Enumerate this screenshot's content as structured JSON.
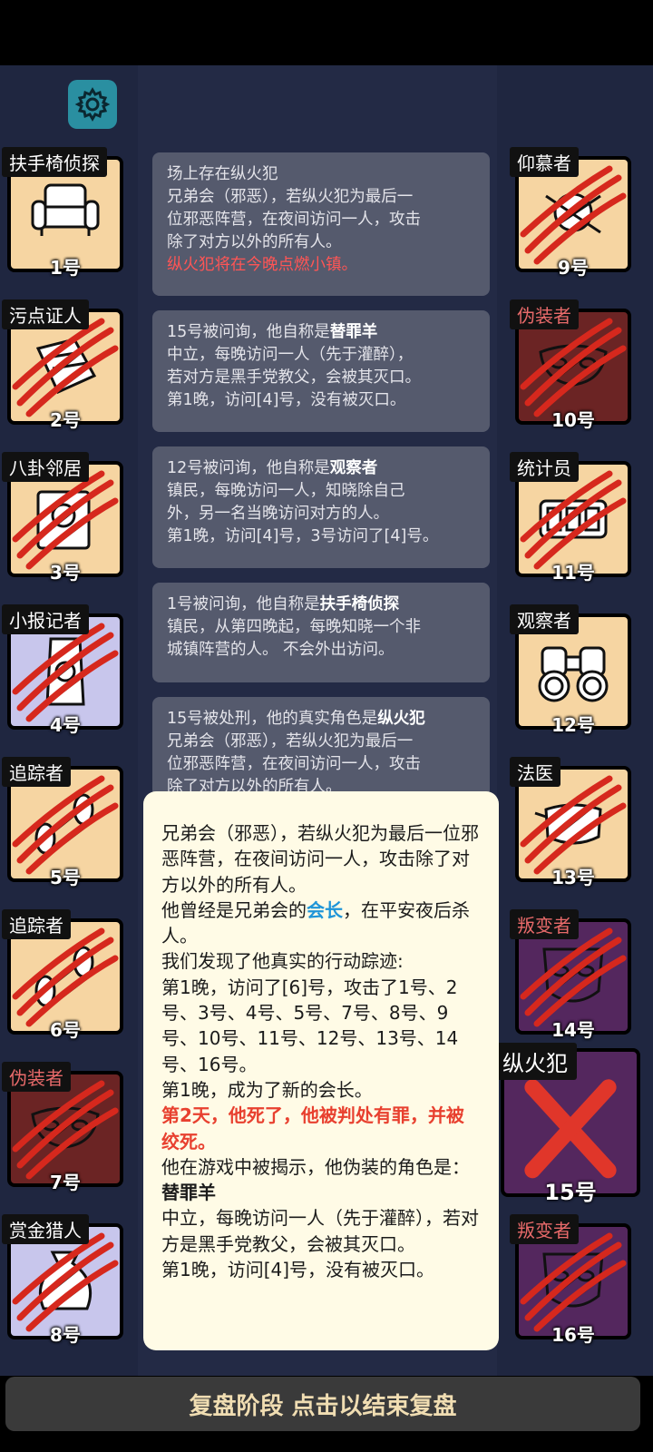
{
  "players_left": [
    {
      "role": "扶手椅侦探",
      "number": "1号",
      "bg": "peach",
      "icon": "armchair-icon",
      "slashed": false,
      "tag_color": "#ffffff"
    },
    {
      "role": "污点证人",
      "number": "2号",
      "bg": "peach",
      "icon": "paper-icon",
      "slashed": true,
      "tag_color": "#ffffff"
    },
    {
      "role": "八卦邻居",
      "number": "3号",
      "bg": "peach",
      "icon": "gossip-icon",
      "slashed": true,
      "tag_color": "#ffffff"
    },
    {
      "role": "小报记者",
      "number": "4号",
      "bg": "lav",
      "icon": "reporter-icon",
      "slashed": true,
      "tag_color": "#ffffff"
    },
    {
      "role": "追踪者",
      "number": "5号",
      "bg": "peach",
      "icon": "footprint-icon",
      "slashed": true,
      "tag_color": "#ffffff"
    },
    {
      "role": "追踪者",
      "number": "6号",
      "bg": "peach",
      "icon": "footprint-icon",
      "slashed": true,
      "tag_color": "#ffffff"
    },
    {
      "role": "伪装者",
      "number": "7号",
      "bg": "maroon",
      "icon": "mask-icon",
      "slashed": true,
      "tag_color": "#e86a6a"
    },
    {
      "role": "赏金猎人",
      "number": "8号",
      "bg": "lav",
      "icon": "money-bag-icon",
      "slashed": true,
      "tag_color": "#ffffff"
    }
  ],
  "players_right": [
    {
      "role": "仰慕者",
      "number": "9号",
      "bg": "peach",
      "icon": "admirer-icon",
      "slashed": true,
      "tag_color": "#ffffff"
    },
    {
      "role": "伪装者",
      "number": "10号",
      "bg": "maroon",
      "icon": "mask-icon",
      "slashed": true,
      "tag_color": "#e86a6a"
    },
    {
      "role": "统计员",
      "number": "11号",
      "bg": "peach",
      "icon": "counter-icon",
      "slashed": true,
      "tag_color": "#ffffff"
    },
    {
      "role": "观察者",
      "number": "12号",
      "bg": "peach",
      "icon": "binoculars-icon",
      "slashed": false,
      "tag_color": "#ffffff"
    },
    {
      "role": "法医",
      "number": "13号",
      "bg": "peach",
      "icon": "face-mask-icon",
      "slashed": true,
      "tag_color": "#ffffff"
    },
    {
      "role": "叛变者",
      "number": "14号",
      "bg": "purple",
      "icon": "traitor-mask-icon",
      "slashed": true,
      "tag_color": "#e86a6a"
    },
    {
      "role": "纵火犯",
      "number": "15号",
      "bg": "purple",
      "icon": "cross-icon",
      "slashed": false,
      "tag_color": "#ffffff"
    },
    {
      "role": "叛变者",
      "number": "16号",
      "bg": "purple",
      "icon": "traitor-mask-icon",
      "slashed": true,
      "tag_color": "#e86a6a"
    }
  ],
  "messages": [
    {
      "lines": [
        "场上存在纵火犯",
        "兄弟会（邪恶），若纵火犯为最后一",
        "位邪恶阵营，在夜间访问一人，攻击",
        "除了对方以外的所有人。"
      ],
      "warning": "纵火犯将在今晚点燃小镇。"
    },
    {
      "head": "15号被问询，他自称是",
      "head_bold": "替罪羊",
      "lines": [
        "中立，每晚访问一人（先于灌醉），",
        "若对方是黑手党教父，会被其灭口。",
        "第1晚，访问[4]号，没有被灭口。"
      ]
    },
    {
      "head": "12号被问询，他自称是",
      "head_bold": "观察者",
      "lines": [
        "镇民，每晚访问一人，知晓除自己",
        "外，另一名当晚访问对方的人。",
        "第1晚，访问[4]号，3号访问了[4]号。"
      ]
    },
    {
      "head": "1号被问询，他自称是",
      "head_bold": "扶手椅侦探",
      "lines": [
        "镇民，从第四晚起，每晚知晓一个非",
        "城镇阵营的人。 不会外出访问。"
      ]
    },
    {
      "head": "15号被处刑，他的真实角色是",
      "head_bold": "纵火犯",
      "lines": [
        "兄弟会（邪恶），若纵火犯为最后一",
        "位邪恶阵营，在夜间访问一人，攻击",
        "除了对方以外的所有人。"
      ]
    }
  ],
  "popup": {
    "p1": "兄弟会（邪恶），若纵火犯为最后一位邪恶阵营，在夜间访问一人，攻击除了对方以外的所有人。",
    "p2_pre": "他曾经是兄弟会的",
    "p2_highlight": "会长",
    "p2_post": "，在平安夜后杀人。",
    "p3": "我们发现了他真实的行动踪迹:",
    "p4": "第1晚，访问了[6]号，攻击了1号、2号、3号、4号、5号、7号、8号、9号、10号、11号、12号、13号、14号、16号。",
    "p5": "第1晚，成为了新的会长。",
    "p6": "第2天，他死了，他被判处有罪，并被绞死。",
    "p7_pre": "他在游戏中被揭示，他伪装的角色是：",
    "p7_bold": "替罪羊",
    "p8": "中立，每晚访问一人（先于灌醉），若对方是黑手党教父，会被其灭口。",
    "p9": "第1晚，访问[4]号，没有被灭口。"
  },
  "bottom_button": "复盘阶段 点击以结束复盘",
  "colors": {
    "peach": "#f6d5a2",
    "lav": "#c8c6ec",
    "maroon": "#6b2424",
    "purple": "#54275e",
    "slash": "#d6281d"
  }
}
